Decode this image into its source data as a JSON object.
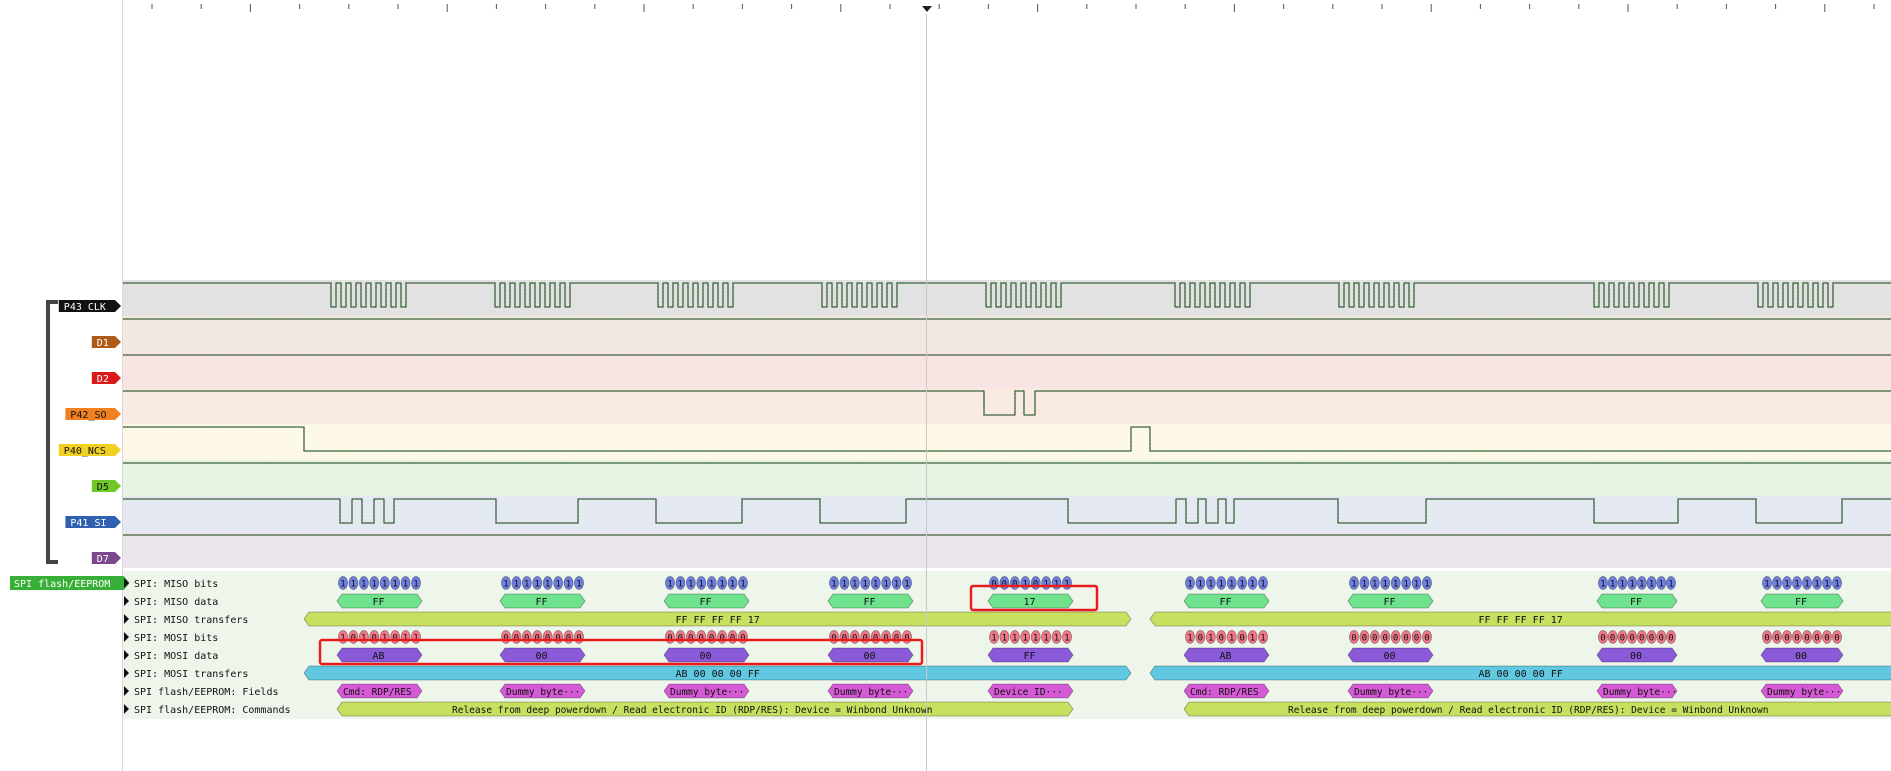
{
  "channels": [
    {
      "label": "P43_CLK",
      "tag_color": "#111111",
      "text_color": "#ffffff",
      "bg": "#e2e2e2"
    },
    {
      "label": "D1",
      "tag_color": "#b05a18",
      "text_color": "#ffffff",
      "bg": "#efe9e2"
    },
    {
      "label": "D2",
      "tag_color": "#d81a1a",
      "text_color": "#ffffff",
      "bg": "#f9e4e4"
    },
    {
      "label": "P42_SO",
      "tag_color": "#f08020",
      "text_color": "#111111",
      "bg": "#f9ebe2"
    },
    {
      "label": "P40_NCS",
      "tag_color": "#f0d020",
      "text_color": "#111111",
      "bg": "#fdf9e6"
    },
    {
      "label": "D5",
      "tag_color": "#70c828",
      "text_color": "#111111",
      "bg": "#e9f3e3"
    },
    {
      "label": "P41_SI",
      "tag_color": "#3060b0",
      "text_color": "#ffffff",
      "bg": "#e4e8f0"
    },
    {
      "label": "D7",
      "tag_color": "#7a4a8c",
      "text_color": "#ffffff",
      "bg": "#ebe4ed"
    }
  ],
  "decoder": {
    "name": "SPI flash/EEPROM",
    "color": "#38b038",
    "rows": [
      {
        "label": "SPI: MISO bits"
      },
      {
        "label": "SPI: MISO data"
      },
      {
        "label": "SPI: MISO transfers"
      },
      {
        "label": "SPI: MOSI bits"
      },
      {
        "label": "SPI: MOSI data"
      },
      {
        "label": "SPI: MOSI transfers"
      },
      {
        "label": "SPI flash/EEPROM: Fields"
      },
      {
        "label": "SPI flash/EEPROM: Commands"
      }
    ]
  },
  "transactions": [
    {
      "miso_bits": [
        "11111111",
        "11111111",
        "11111111",
        "11111111",
        "00010111"
      ],
      "miso_data": [
        "FF",
        "FF",
        "FF",
        "FF",
        "17"
      ],
      "miso_transfer": "FF FF FF FF 17",
      "mosi_bits": [
        "10101011",
        "00000000",
        "00000000",
        "00000000",
        "11111111"
      ],
      "mosi_data": [
        "AB",
        "00",
        "00",
        "00",
        "FF"
      ],
      "mosi_transfer": "AB 00 00 00 FF",
      "fields": [
        "Cmd: RDP/RES",
        "Dummy byte···",
        "Dummy byte···",
        "Dummy byte···",
        "Device ID···"
      ],
      "command": "Release from deep powerdown / Read electronic ID (RDP/RES): Device = Winbond Unknown"
    },
    {
      "miso_bits": [
        "11111111",
        "11111111",
        "11111111",
        "11111111"
      ],
      "miso_data": [
        "FF",
        "FF",
        "FF",
        "FF"
      ],
      "miso_transfer": "FF FF FF FF 17",
      "mosi_bits": [
        "10101011",
        "00000000",
        "00000000",
        "00000000"
      ],
      "mosi_data": [
        "AB",
        "00",
        "00",
        "00"
      ],
      "mosi_transfer": "AB 00 00 00 FF",
      "fields": [
        "Cmd: RDP/RES",
        "Dummy byte···",
        "Dummy byte···",
        "Dummy byte···"
      ],
      "command": "Release from deep powerdown / Read electronic ID (RDP/RES): Device = Winbond Unknown"
    }
  ],
  "colors": {
    "miso_bits": "#6f7fe0",
    "miso_data": "#6fe28e",
    "transfers_miso": "#c8e060",
    "mosi_bits": "#f07888",
    "mosi_data": "#8a5ad8",
    "transfers_mosi": "#60c8e0",
    "fields": "#d65ad6",
    "commands": "#c8e060",
    "highlight": "#e81c1c",
    "wave_high": "#2e8a2e",
    "wave_low": "#b03030"
  }
}
